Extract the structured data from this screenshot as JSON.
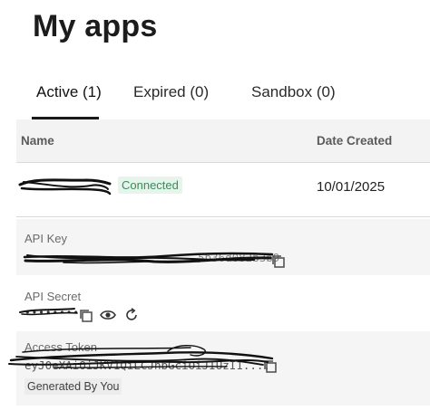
{
  "page": {
    "title": "My apps"
  },
  "tabs": [
    {
      "label": "Active (1)",
      "active": true
    },
    {
      "label": "Expired (0)",
      "active": false
    },
    {
      "label": "Sandbox (0)",
      "active": false
    }
  ],
  "table": {
    "columns": [
      "Name",
      "Date Created"
    ],
    "rows": [
      {
        "name": "",
        "status": "Connected",
        "date_created": "10/01/2025"
      }
    ]
  },
  "details": {
    "api_key": {
      "label": "API Key",
      "value": "5b36d082b3b9"
    },
    "api_secret": {
      "label": "API Secret",
      "value": "••••••••"
    },
    "access_token": {
      "label": "Access Token",
      "value": "eyJ0eXAiOiJKV1QiLCJhbGciOiJIUzI1....",
      "badge": "Generated By You"
    }
  },
  "icons": {
    "copy": "copy-icon",
    "reveal": "eye-icon",
    "regenerate": "refresh-icon"
  },
  "colors": {
    "badge_bg": "#e6f4ec",
    "badge_text": "#3c8a5c",
    "header_bg": "#f3f3f3",
    "detail_bg": "#f5f5f5"
  }
}
